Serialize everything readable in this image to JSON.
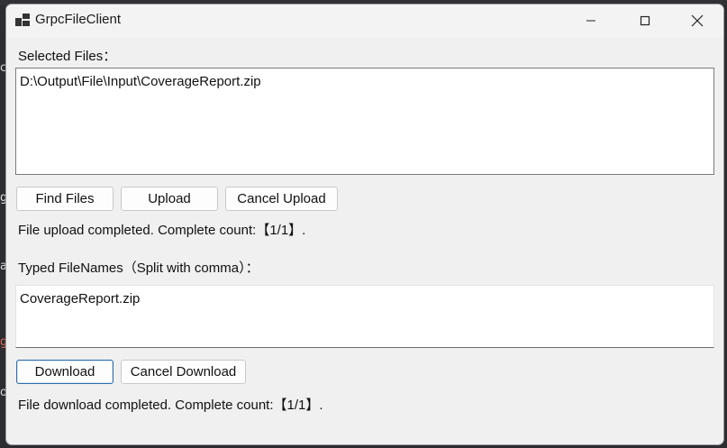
{
  "window": {
    "title": "GrpcFileClient"
  },
  "upload": {
    "label": "Selected Files：",
    "files_text": "D:\\Output\\File\\Input\\CoverageReport.zip",
    "buttons": {
      "find": "Find Files",
      "upload": "Upload",
      "cancel": "Cancel Upload"
    },
    "status": "File upload completed. Complete count:【1/1】."
  },
  "download": {
    "label": "Typed FileNames（Split with comma）：",
    "names_text": "CoverageReport.zip",
    "buttons": {
      "download": "Download",
      "cancel": "Cancel Download"
    },
    "status": "File download completed. Complete count:【1/1】."
  }
}
